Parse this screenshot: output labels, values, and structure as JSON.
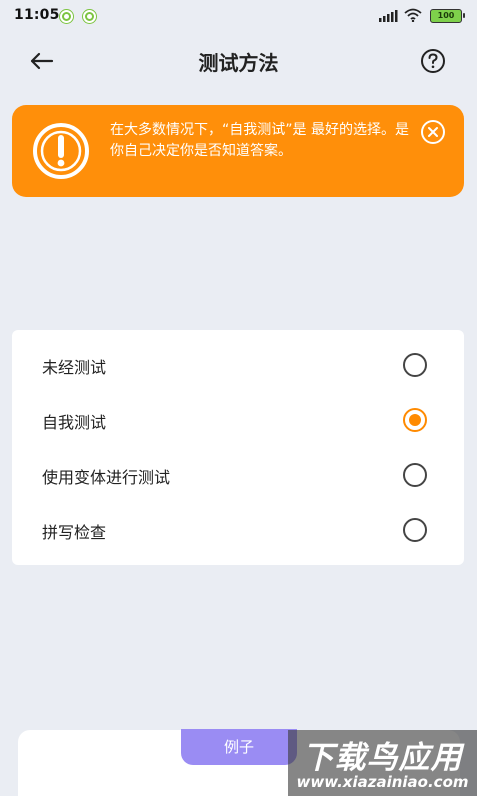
{
  "status_bar": {
    "time": "11:05",
    "battery": "100"
  },
  "header": {
    "title": "测试方法"
  },
  "banner": {
    "message": "在大多数情况下，“自我测试”是 最好的选择。是你自己决定你是否知道答案。"
  },
  "options": [
    {
      "label": "未经测试",
      "selected": false
    },
    {
      "label": "自我测试",
      "selected": true
    },
    {
      "label": "使用变体进行测试",
      "selected": false
    },
    {
      "label": "拼写检查",
      "selected": false
    }
  ],
  "example": {
    "tab_label": "例子"
  },
  "watermark": {
    "title": "下载鸟应用",
    "url": "www.xiazainiao.com"
  },
  "colors": {
    "accent": "#ff8f0a",
    "example_tab": "#9a8cf3",
    "background": "#eaedf3"
  }
}
